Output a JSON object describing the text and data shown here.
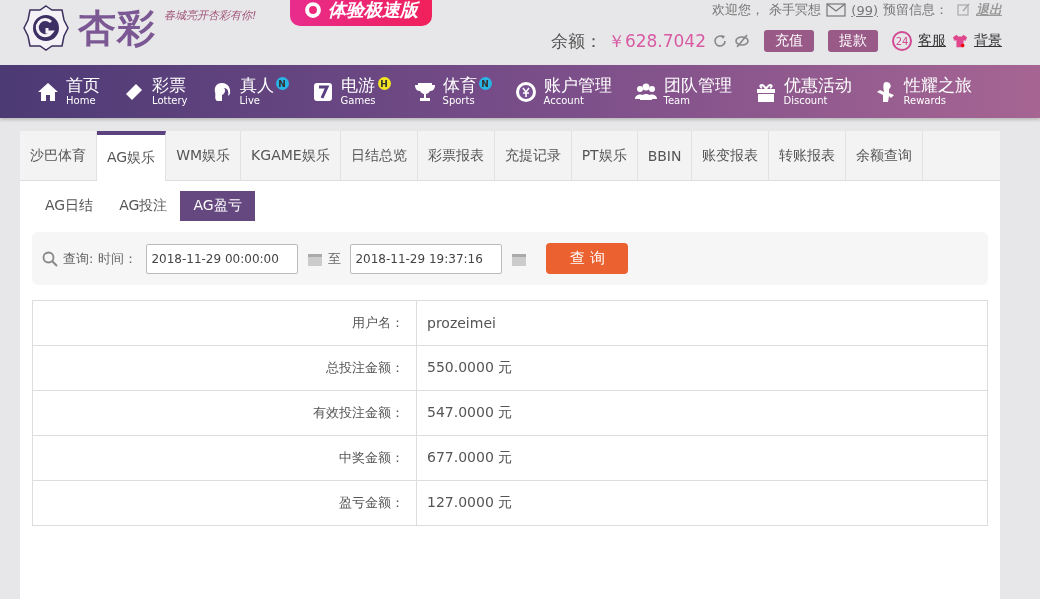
{
  "header": {
    "brand": "杏彩",
    "slogan": "春城亮开杏彩有你!",
    "speed_button": "体验极速版",
    "welcome": "欢迎您，",
    "username": "杀手冥想",
    "messages": "(99)",
    "reserved_info": "预留信息：",
    "logout": "退出",
    "balance_label": "余额：",
    "balance": "￥628.7042",
    "deposit": "充值",
    "withdraw": "提款",
    "service_badge": "24",
    "service": "客服",
    "background": "背景"
  },
  "nav": [
    {
      "kind": "home",
      "label": "首页",
      "sub": "Home"
    },
    {
      "kind": "lottery",
      "label": "彩票",
      "sub": "Lottery"
    },
    {
      "kind": "live",
      "label": "真人",
      "sub": "Live",
      "badge": "N",
      "color": "#2ab4e6"
    },
    {
      "kind": "games",
      "label": "电游",
      "sub": "Games",
      "badge": "H",
      "color": "#f2e422"
    },
    {
      "kind": "sports",
      "label": "体育",
      "sub": "Sports",
      "badge": "N",
      "color": "#2ab4e6"
    },
    {
      "kind": "account",
      "label": "账户管理",
      "sub": "Account"
    },
    {
      "kind": "team",
      "label": "团队管理",
      "sub": "Team"
    },
    {
      "kind": "discount",
      "label": "优惠活动",
      "sub": "Discount"
    },
    {
      "kind": "rewards",
      "label": "性耀之旅",
      "sub": "Rewards"
    }
  ],
  "tabs": [
    {
      "label": "沙巴体育",
      "selected": false
    },
    {
      "label": "AG娱乐",
      "selected": true
    },
    {
      "label": "WM娱乐",
      "selected": false
    },
    {
      "label": "KGAME娱乐",
      "selected": false
    },
    {
      "label": "日结总览",
      "selected": false
    },
    {
      "label": "彩票报表",
      "selected": false
    },
    {
      "label": "充提记录",
      "selected": false
    },
    {
      "label": "PT娱乐",
      "selected": false
    },
    {
      "label": "BBIN",
      "selected": false
    },
    {
      "label": "账变报表",
      "selected": false
    },
    {
      "label": "转账报表",
      "selected": false
    },
    {
      "label": "余额查询",
      "selected": false
    }
  ],
  "subtabs": [
    {
      "label": "AG日结",
      "selected": false
    },
    {
      "label": "AG投注",
      "selected": false
    },
    {
      "label": "AG盈亏",
      "selected": true
    }
  ],
  "query": {
    "label": "查询:",
    "time_label": "时间：",
    "start": "2018-11-29 00:00:00",
    "to": "至",
    "end": "2018-11-29 19:37:16",
    "button": "查 询"
  },
  "table": {
    "rows": [
      {
        "label": "用户名：",
        "value": "prozeimei"
      },
      {
        "label": "总投注金额：",
        "value": "550.0000 元"
      },
      {
        "label": "有效投注金额：",
        "value": "547.0000 元"
      },
      {
        "label": "中奖金额：",
        "value": "677.0000 元"
      },
      {
        "label": "盈亏金额：",
        "value": "127.0000 元"
      }
    ]
  }
}
